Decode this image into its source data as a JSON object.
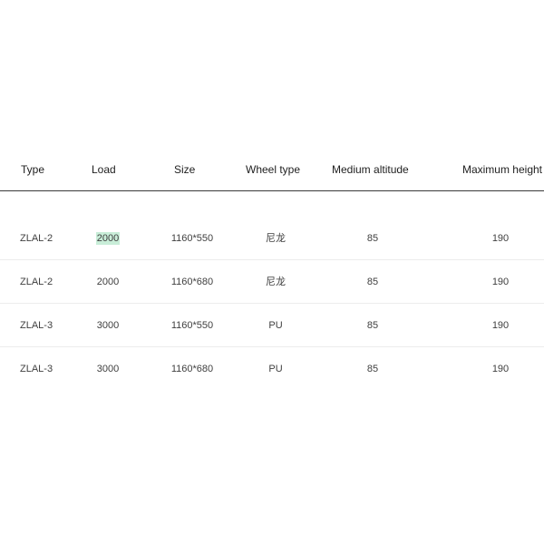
{
  "table": {
    "headers": [
      "Type",
      "Load",
      "Size",
      "Wheel type",
      "Medium altitude",
      "Maximum height"
    ],
    "rows": [
      [
        "ZLAL-2",
        "2000",
        "1160*550",
        "尼龙",
        "85",
        "190"
      ],
      [
        "ZLAL-2",
        "2000",
        "1160*680",
        "尼龙",
        "85",
        "190"
      ],
      [
        "ZLAL-3",
        "3000",
        "1160*550",
        "PU",
        "85",
        "190"
      ],
      [
        "ZLAL-3",
        "3000",
        "1160*680",
        "PU",
        "85",
        "190"
      ]
    ]
  },
  "colors": {
    "highlight": "#c8edd8",
    "header_rule": "#3a3a3a",
    "row_rule": "#ececec",
    "header_text": "#1e1e1e",
    "cell_text": "#404040"
  }
}
